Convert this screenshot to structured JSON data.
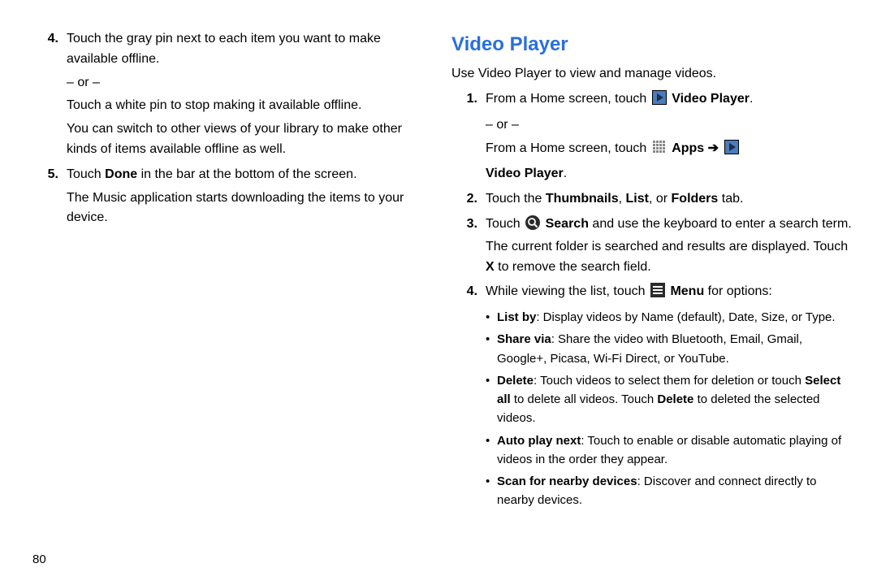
{
  "pageNumber": "80",
  "left": {
    "items": [
      {
        "num": "4.",
        "paragraphs": [
          "Touch the gray pin next to each item you want to make available offline.",
          "– or –",
          "Touch a white pin to stop making it available offline.",
          "You can switch to other views of your library to make other kinds of items available offline as well."
        ]
      },
      {
        "num": "5.",
        "done_label": "Done",
        "p1_before": "Touch ",
        "p1_after": " in the bar at the bottom of the screen.",
        "p2": "The Music application starts downloading the items to your device."
      }
    ]
  },
  "right": {
    "heading": "Video Player",
    "intro": "Use Video Player to view and manage videos.",
    "items": [
      {
        "num": "1.",
        "line1_before": "From a Home screen, touch ",
        "vp_label": "Video Player",
        "period": ".",
        "or": "– or –",
        "line2_before": "From a Home screen, touch ",
        "apps_label": "Apps",
        "arrow": " ➔ ",
        "vp_label2": "Video Player",
        "period2": "."
      },
      {
        "num": "2.",
        "before": "Touch the ",
        "b1": "Thumbnails",
        "c1": ", ",
        "b2": "List",
        "c2": ", or ",
        "b3": "Folders",
        "after": " tab."
      },
      {
        "num": "3.",
        "before": "Touch ",
        "search_label": "Search",
        "mid": " and use the keyboard to enter a search term. The current folder is searched and results are displayed. Touch ",
        "x_label": "X",
        "after": " to remove the search field."
      },
      {
        "num": "4.",
        "before": "While viewing the list, touch ",
        "menu_label": "Menu",
        "after": " for options:",
        "bullets": [
          {
            "b": "List by",
            "t": ": Display videos by Name (default), Date, Size, or Type."
          },
          {
            "b": "Share via",
            "t": ": Share the video with Bluetooth, Email, Gmail, Google+, Picasa, Wi-Fi Direct, or YouTube."
          },
          {
            "b": "Delete",
            "t_before": ": Touch videos to select them for deletion or touch ",
            "b2": "Select all",
            "t_mid": " to delete all videos. Touch ",
            "b3": "Delete",
            "t_after": " to deleted the selected videos."
          },
          {
            "b": "Auto play next",
            "t": ": Touch to enable or disable automatic playing of videos in the order they appear."
          },
          {
            "b": "Scan for nearby devices",
            "t": ": Discover and connect directly to nearby devices."
          }
        ]
      }
    ]
  }
}
